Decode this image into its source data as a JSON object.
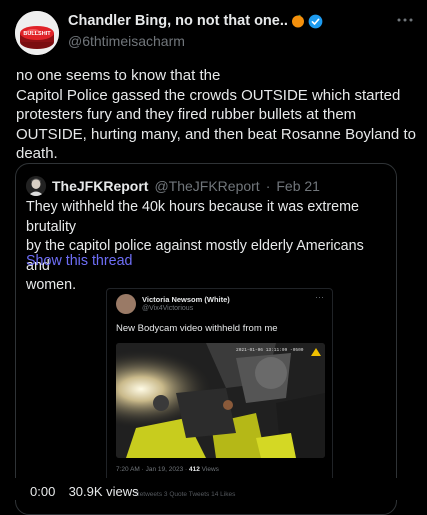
{
  "tweet": {
    "display_name": "Chandler Bing, no not that one..",
    "handle": "@6thtimeisacharm",
    "avatar_text": "BULLSHIT",
    "body_lines": [
      "no one seems to know that the",
      "Capitol Police gassed the crowds OUTSIDE which started",
      "protesters fury and they fired rubber bullets at them",
      "OUTSIDE, hurting many, and then beat Rosanne Boyland to",
      "death."
    ]
  },
  "quote": {
    "name": "TheJFKReport",
    "handle": "@TheJFKReport",
    "separator": "·",
    "date": "Feb 21",
    "text_lines": [
      "They withheld the 40k hours because it was extreme brutality",
      "by the capitol police against mostly elderly Americans and",
      "women."
    ],
    "show_thread": "Show this thread"
  },
  "embedded": {
    "name": "Victoria Newsom (White)",
    "handle": "@Vix4Victorious",
    "text": "New Bodycam video withheld from me",
    "timestamp_overlay": "2021-01-06 13:11:09 -0500",
    "stats_time": "7:20 AM · Jan 19, 2023 · ",
    "stats_views_num": "412",
    "stats_views_label": " Views"
  },
  "video_overlay": {
    "time": "0:00",
    "views": "30.9K views"
  },
  "bottom_dim": "Retweets   3 Quote Tweets   14 Likes",
  "colors": {
    "background": "#000000",
    "text": "#e7e9ea",
    "muted": "#71767b",
    "link": "#6e6ef7",
    "verified": "#1d9bf0",
    "emoji": "#f4900c"
  }
}
